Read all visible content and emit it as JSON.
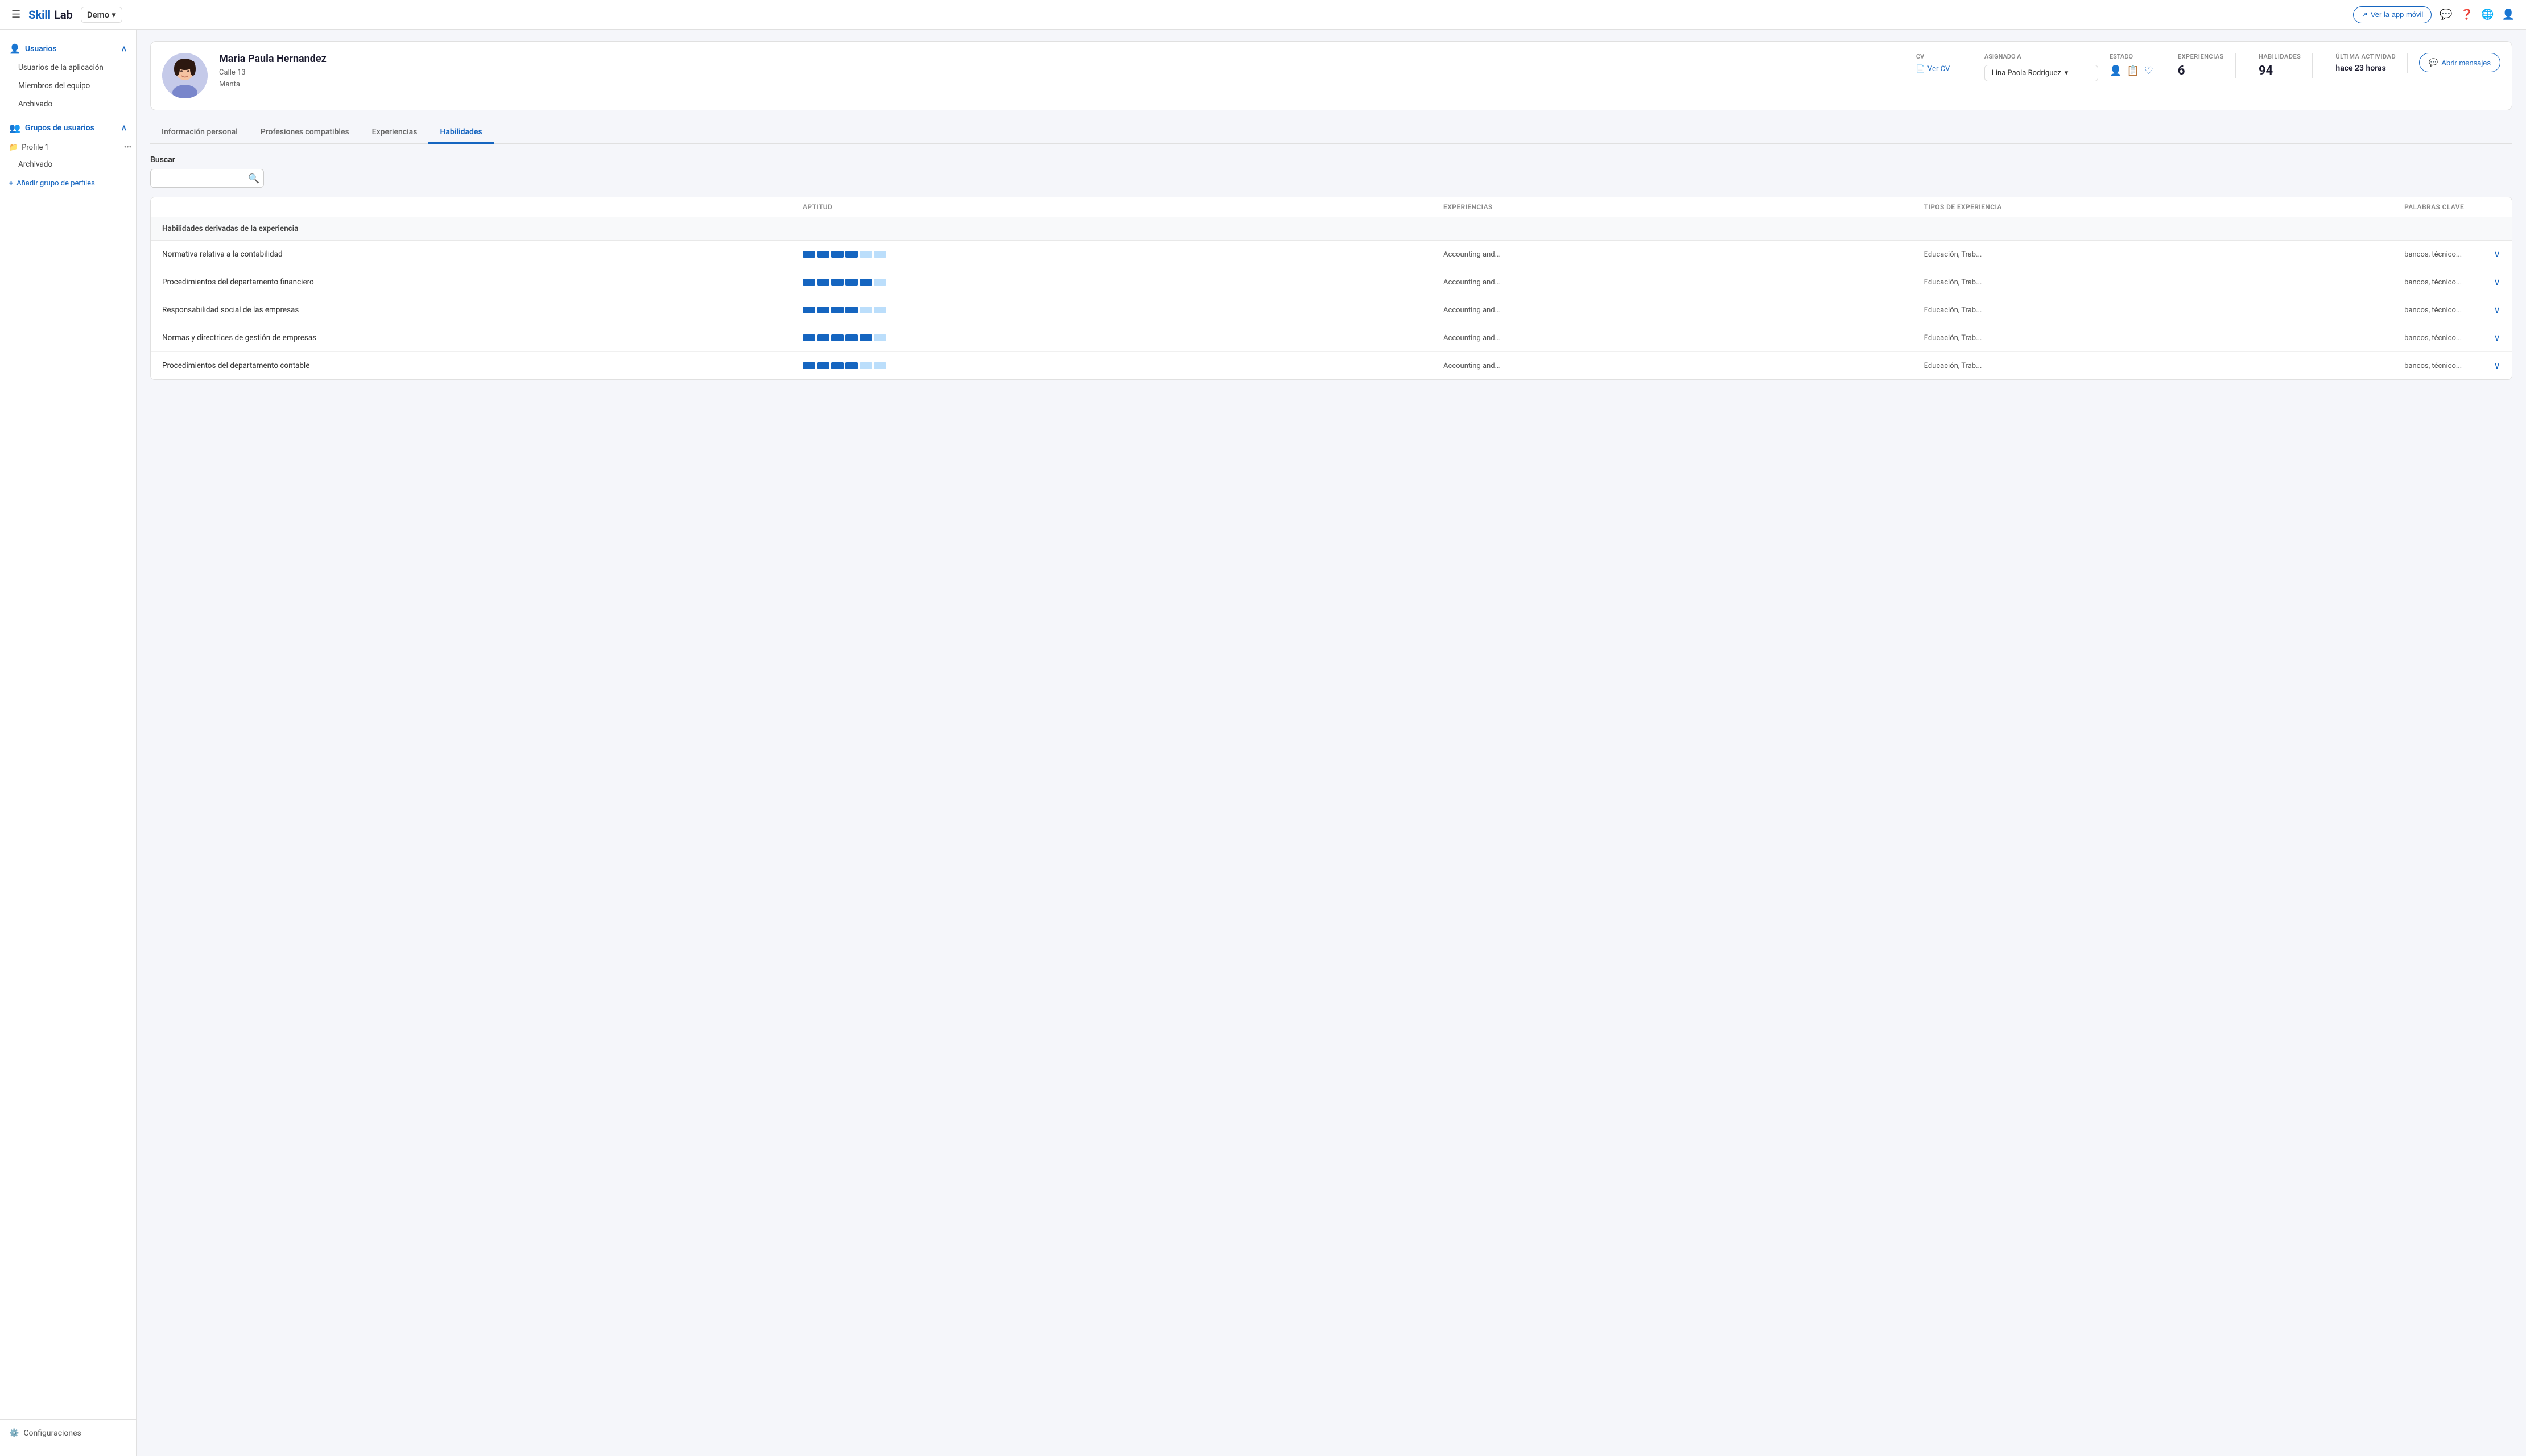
{
  "brand": {
    "name_part1": "Skill",
    "name_part2": "Lab",
    "demo_label": "Demo"
  },
  "topnav": {
    "app_movil_label": "Ver la app móvil"
  },
  "sidebar": {
    "usuarios_label": "Usuarios",
    "usuarios_items": [
      {
        "id": "app-users",
        "label": "Usuarios de la aplicación"
      },
      {
        "id": "team-members",
        "label": "Miembros del equipo"
      },
      {
        "id": "archived",
        "label": "Archivado"
      }
    ],
    "grupos_label": "Grupos de usuarios",
    "profile1_label": "Profile 1",
    "archivado_label": "Archivado",
    "add_group_label": "Añadir grupo de perfiles",
    "config_label": "Configuraciones"
  },
  "user": {
    "name": "Maria Paula Hernandez",
    "address_line1": "Calle 13",
    "address_line2": "Manta",
    "cv_label": "Ver CV",
    "asignado_a_label": "ASIGNADO A",
    "asignado_nombre": "Lina Paola Rodriguez",
    "estado_label": "ESTADO",
    "experiencias_label": "EXPERIENCIAS",
    "experiencias_value": "6",
    "habilidades_label": "HABILIDADES",
    "habilidades_value": "94",
    "ultima_actividad_label": "ÚLTIMA ACTIVIDAD",
    "ultima_actividad_value": "hace 23 horas",
    "open_message_label": "Abrir mensajes"
  },
  "tabs": [
    {
      "id": "info-personal",
      "label": "Información personal"
    },
    {
      "id": "profesiones",
      "label": "Profesiones compatibles"
    },
    {
      "id": "experiencias",
      "label": "Experiencias"
    },
    {
      "id": "habilidades",
      "label": "Habilidades",
      "active": true
    }
  ],
  "search": {
    "label": "Buscar",
    "placeholder": ""
  },
  "table": {
    "headers": {
      "aptitud": "Aptitud",
      "experiencias": "Experiencias",
      "tipos_exp": "Tipos de experiencia",
      "palabras_clave": "Palabras clave"
    },
    "section_label": "Habilidades derivadas de la experiencia",
    "rows": [
      {
        "skill": "Normativa relativa a la contabilidad",
        "bars": [
          1,
          1,
          1,
          1,
          0,
          0
        ],
        "experiencias": "Accounting and...",
        "tipos": "Educación, Trab...",
        "palabras": "bancos, técnico..."
      },
      {
        "skill": "Procedimientos del departamento financiero",
        "bars": [
          1,
          1,
          1,
          1,
          1,
          0
        ],
        "experiencias": "Accounting and...",
        "tipos": "Educación, Trab...",
        "palabras": "bancos, técnico..."
      },
      {
        "skill": "Responsabilidad social de las empresas",
        "bars": [
          1,
          1,
          1,
          1,
          0,
          0
        ],
        "experiencias": "Accounting and...",
        "tipos": "Educación, Trab...",
        "palabras": "bancos, técnico..."
      },
      {
        "skill": "Normas y directrices de gestión de empresas",
        "bars": [
          1,
          1,
          1,
          1,
          1,
          0
        ],
        "experiencias": "Accounting and...",
        "tipos": "Educación, Trab...",
        "palabras": "bancos, técnico..."
      },
      {
        "skill": "Procedimientos del departamento contable",
        "bars": [
          1,
          1,
          1,
          1,
          0,
          0
        ],
        "experiencias": "Accounting and...",
        "tipos": "Educación, Trab...",
        "palabras": "bancos, técnico..."
      }
    ]
  }
}
